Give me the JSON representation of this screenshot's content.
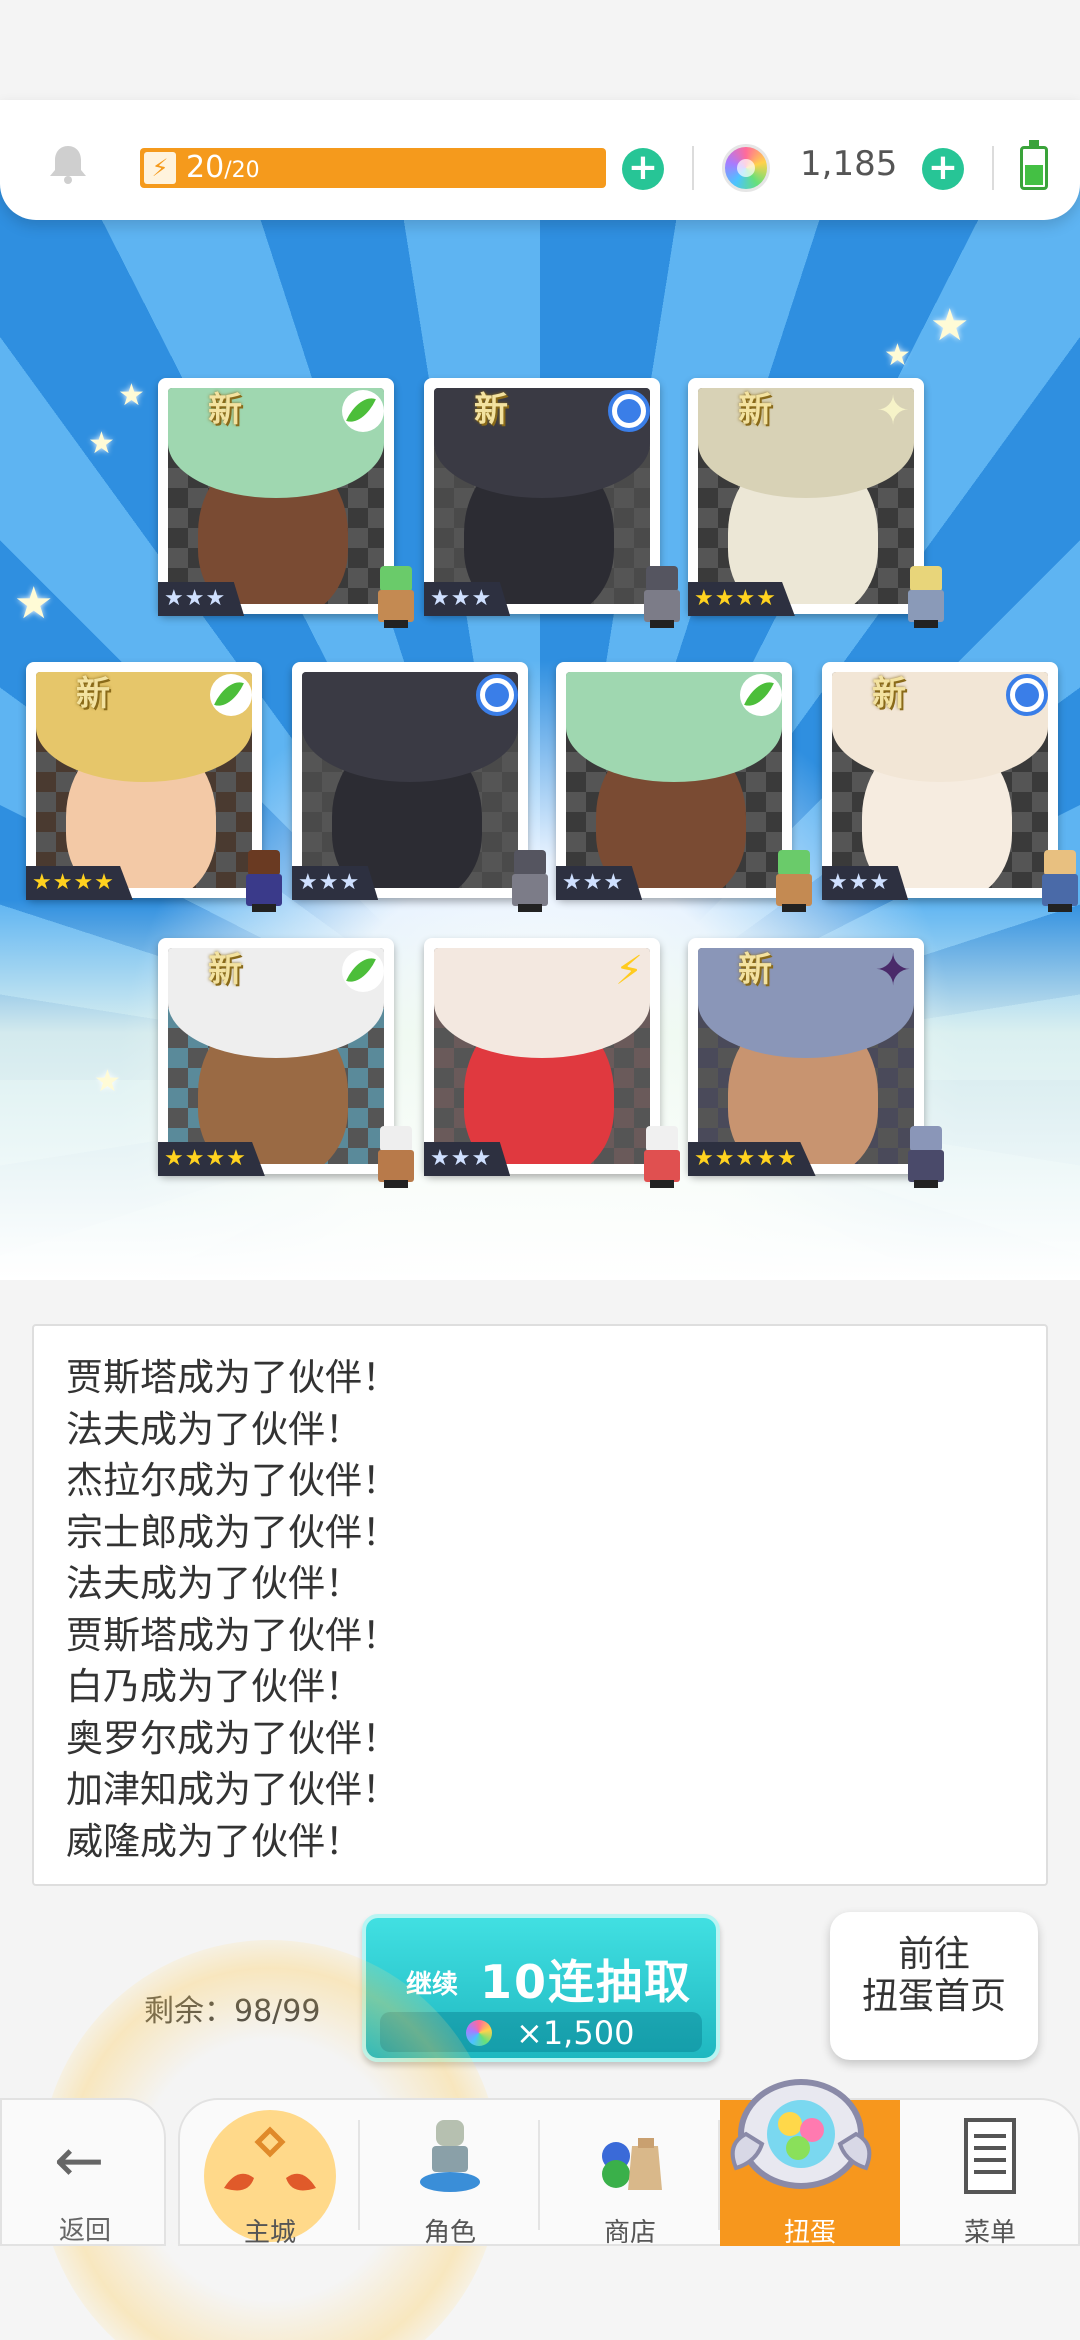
{
  "topbar": {
    "energy_current": "20",
    "energy_max": "/20",
    "gems": "1,185"
  },
  "cards": [
    {
      "new": "新",
      "element": "grass",
      "rarity": "★★★",
      "tier": "silver",
      "hair": "#9fd7b0",
      "skin": "#7a4b33",
      "bg": "#3a3a3a",
      "sprite_hair": "#6acb6a",
      "sprite_body": "#c48a52"
    },
    {
      "new": "新",
      "element": "water",
      "rarity": "★★★",
      "tier": "silver",
      "hair": "#3a3a44",
      "skin": "#2c2c33",
      "bg": "#4a4a4a",
      "sprite_hair": "#555560",
      "sprite_body": "#7c7c88"
    },
    {
      "new": "新",
      "element": "light",
      "rarity": "★★★★",
      "tier": "gold",
      "hair": "#d8d2b6",
      "skin": "#ece7d6",
      "bg": "#3a3a3a",
      "sprite_hair": "#e8d57a",
      "sprite_body": "#8a9ab8"
    },
    {
      "new": "新",
      "element": "grass",
      "rarity": "★★★★",
      "tier": "gold",
      "hair": "#e6c66a",
      "skin": "#f3c9a6",
      "bg": "#4a3a30",
      "sprite_hair": "#6a3a22",
      "sprite_body": "#3a3a8a"
    },
    {
      "new": "",
      "element": "water",
      "rarity": "★★★",
      "tier": "silver",
      "hair": "#3a3a44",
      "skin": "#2c2c33",
      "bg": "#4a4a4a",
      "sprite_hair": "#555560",
      "sprite_body": "#7c7c88"
    },
    {
      "new": "",
      "element": "grass",
      "rarity": "★★★",
      "tier": "silver",
      "hair": "#9fd7b0",
      "skin": "#7a4b33",
      "bg": "#3a3a3a",
      "sprite_hair": "#6acb6a",
      "sprite_body": "#c48a52"
    },
    {
      "new": "新",
      "element": "water",
      "rarity": "★★★",
      "tier": "silver",
      "hair": "#f2e6d6",
      "skin": "#f6ece0",
      "bg": "#3a3a3a",
      "sprite_hair": "#e8c080",
      "sprite_body": "#4a6aa8"
    },
    {
      "new": "新",
      "element": "grass",
      "rarity": "★★★★",
      "tier": "gold",
      "hair": "#eeeeee",
      "skin": "#9a6a44",
      "bg": "#5a8a9a",
      "sprite_hair": "#eeeeee",
      "sprite_body": "#b87a4a"
    },
    {
      "new": "",
      "element": "thunder",
      "rarity": "★★★",
      "tier": "silver",
      "hair": "#f3e8e0",
      "skin": "#e0393f",
      "bg": "#6a5a5a",
      "sprite_hair": "#f0f0f0",
      "sprite_body": "#e05050"
    },
    {
      "new": "新",
      "element": "dark",
      "rarity": "★★★★★",
      "tier": "gold",
      "hair": "#8a96b8",
      "skin": "#c89470",
      "bg": "#4a4a5a",
      "sprite_hair": "#8a96b8",
      "sprite_body": "#4a4a6a"
    }
  ],
  "log": [
    "贾斯塔成为了伙伴！",
    "法夫成为了伙伴！",
    "杰拉尔成为了伙伴！",
    "宗士郎成为了伙伴！",
    "法夫成为了伙伴！",
    "贾斯塔成为了伙伴！",
    "白乃成为了伙伴！",
    "奥罗尔成为了伙伴！",
    "加津知成为了伙伴！",
    "威隆成为了伙伴！"
  ],
  "draw": {
    "remaining": "剩余：98/99",
    "continue_label": "继续",
    "main_label": "10连抽取",
    "cost": "×1,500"
  },
  "home_button": {
    "line1": "前往",
    "line2": "扭蛋首页"
  },
  "nav": {
    "back": "返回",
    "tabs": [
      {
        "label": "主城",
        "icon": "town-icon"
      },
      {
        "label": "角色",
        "icon": "character-icon"
      },
      {
        "label": "商店",
        "icon": "shop-icon"
      },
      {
        "label": "扭蛋",
        "icon": "gacha-icon",
        "active": true
      },
      {
        "label": "菜单",
        "icon": "menu-icon"
      }
    ]
  }
}
